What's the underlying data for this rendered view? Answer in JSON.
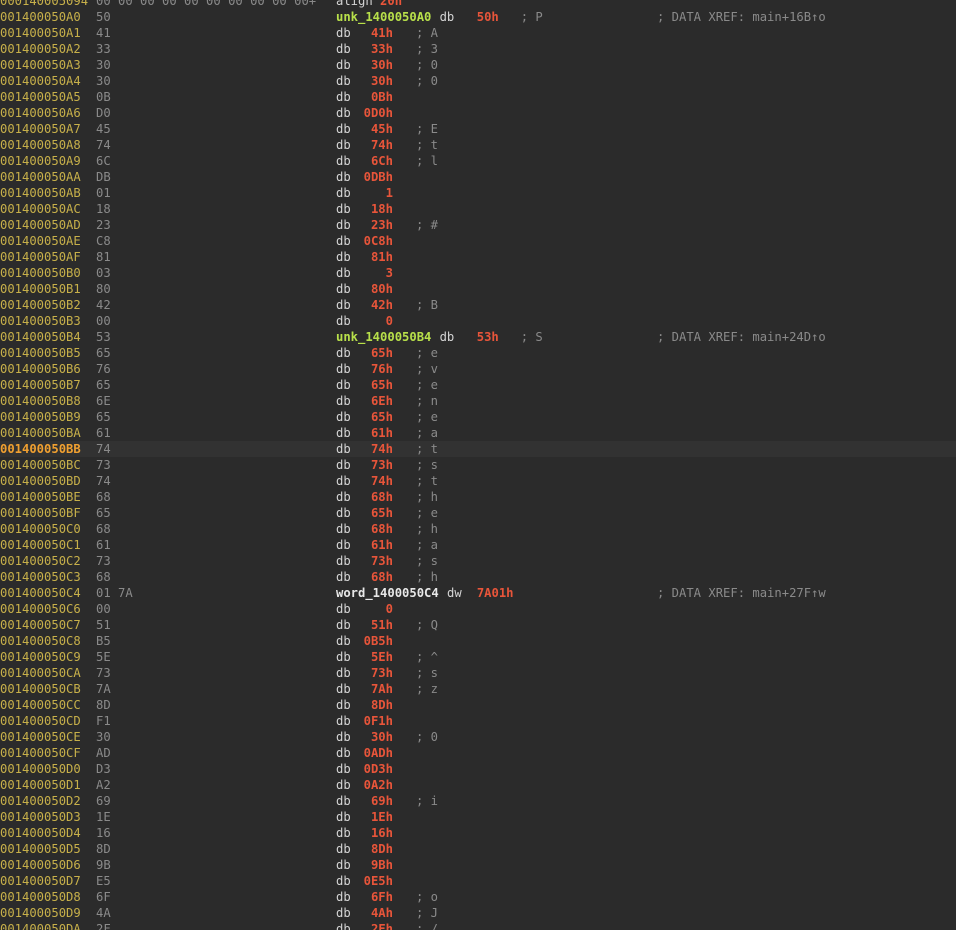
{
  "theme": {
    "background": "#2b2b2b",
    "address": "#c7b04a",
    "address_current": "#f0a030",
    "label": "#b8e04a",
    "value": "#e8553a",
    "comment": "#8a8a8a",
    "text": "#d4d4d4"
  },
  "top_line": {
    "address": "000140005094",
    "bytes": "00 00 00 00 00 00 00 00 00 00+",
    "mnemonic": "align",
    "operand": "20h"
  },
  "rows": [
    {
      "addr": "001400050A0",
      "bytes": "50",
      "label": "unk_1400050A0",
      "mnem": "db",
      "val": "50h",
      "cmt": "; P",
      "xref": "; DATA XREF: main+16B↑o"
    },
    {
      "addr": "001400050A1",
      "bytes": "41",
      "mnem": "db",
      "val": "41h",
      "cmt": "; A"
    },
    {
      "addr": "001400050A2",
      "bytes": "33",
      "mnem": "db",
      "val": "33h",
      "cmt": "; 3"
    },
    {
      "addr": "001400050A3",
      "bytes": "30",
      "mnem": "db",
      "val": "30h",
      "cmt": "; 0"
    },
    {
      "addr": "001400050A4",
      "bytes": "30",
      "mnem": "db",
      "val": "30h",
      "cmt": "; 0"
    },
    {
      "addr": "001400050A5",
      "bytes": "0B",
      "mnem": "db",
      "val": "0Bh"
    },
    {
      "addr": "001400050A6",
      "bytes": "D0",
      "mnem": "db",
      "val": "0D0h"
    },
    {
      "addr": "001400050A7",
      "bytes": "45",
      "mnem": "db",
      "val": "45h",
      "cmt": "; E"
    },
    {
      "addr": "001400050A8",
      "bytes": "74",
      "mnem": "db",
      "val": "74h",
      "cmt": "; t"
    },
    {
      "addr": "001400050A9",
      "bytes": "6C",
      "mnem": "db",
      "val": "6Ch",
      "cmt": "; l"
    },
    {
      "addr": "001400050AA",
      "bytes": "DB",
      "mnem": "db",
      "val": "0DBh"
    },
    {
      "addr": "001400050AB",
      "bytes": "01",
      "mnem": "db",
      "val": "1"
    },
    {
      "addr": "001400050AC",
      "bytes": "18",
      "mnem": "db",
      "val": "18h"
    },
    {
      "addr": "001400050AD",
      "bytes": "23",
      "mnem": "db",
      "val": "23h",
      "cmt": "; #"
    },
    {
      "addr": "001400050AE",
      "bytes": "C8",
      "mnem": "db",
      "val": "0C8h"
    },
    {
      "addr": "001400050AF",
      "bytes": "81",
      "mnem": "db",
      "val": "81h"
    },
    {
      "addr": "001400050B0",
      "bytes": "03",
      "mnem": "db",
      "val": "3"
    },
    {
      "addr": "001400050B1",
      "bytes": "80",
      "mnem": "db",
      "val": "80h"
    },
    {
      "addr": "001400050B2",
      "bytes": "42",
      "mnem": "db",
      "val": "42h",
      "cmt": "; B"
    },
    {
      "addr": "001400050B3",
      "bytes": "00",
      "mnem": "db",
      "val": "0"
    },
    {
      "addr": "001400050B4",
      "bytes": "53",
      "label": "unk_1400050B4",
      "mnem": "db",
      "val": "53h",
      "cmt": "; S",
      "xref": "; DATA XREF: main+24D↑o"
    },
    {
      "addr": "001400050B5",
      "bytes": "65",
      "mnem": "db",
      "val": "65h",
      "cmt": "; e"
    },
    {
      "addr": "001400050B6",
      "bytes": "76",
      "mnem": "db",
      "val": "76h",
      "cmt": "; v"
    },
    {
      "addr": "001400050B7",
      "bytes": "65",
      "mnem": "db",
      "val": "65h",
      "cmt": "; e"
    },
    {
      "addr": "001400050B8",
      "bytes": "6E",
      "mnem": "db",
      "val": "6Eh",
      "cmt": "; n"
    },
    {
      "addr": "001400050B9",
      "bytes": "65",
      "mnem": "db",
      "val": "65h",
      "cmt": "; e"
    },
    {
      "addr": "001400050BA",
      "bytes": "61",
      "mnem": "db",
      "val": "61h",
      "cmt": "; a"
    },
    {
      "addr": "001400050BB",
      "bytes": "74",
      "mnem": "db",
      "val": "74h",
      "cmt": "; t",
      "current": true
    },
    {
      "addr": "001400050BC",
      "bytes": "73",
      "mnem": "db",
      "val": "73h",
      "cmt": "; s"
    },
    {
      "addr": "001400050BD",
      "bytes": "74",
      "mnem": "db",
      "val": "74h",
      "cmt": "; t"
    },
    {
      "addr": "001400050BE",
      "bytes": "68",
      "mnem": "db",
      "val": "68h",
      "cmt": "; h"
    },
    {
      "addr": "001400050BF",
      "bytes": "65",
      "mnem": "db",
      "val": "65h",
      "cmt": "; e"
    },
    {
      "addr": "001400050C0",
      "bytes": "68",
      "mnem": "db",
      "val": "68h",
      "cmt": "; h"
    },
    {
      "addr": "001400050C1",
      "bytes": "61",
      "mnem": "db",
      "val": "61h",
      "cmt": "; a"
    },
    {
      "addr": "001400050C2",
      "bytes": "73",
      "mnem": "db",
      "val": "73h",
      "cmt": "; s"
    },
    {
      "addr": "001400050C3",
      "bytes": "68",
      "mnem": "db",
      "val": "68h",
      "cmt": "; h"
    },
    {
      "addr": "001400050C4",
      "bytes": "01 7A",
      "label": "word_1400050C4",
      "mnem": "dw",
      "val": "7A01h",
      "xref": "; DATA XREF: main+27F↑w",
      "plain": true
    },
    {
      "addr": "001400050C6",
      "bytes": "00",
      "mnem": "db",
      "val": "0"
    },
    {
      "addr": "001400050C7",
      "bytes": "51",
      "mnem": "db",
      "val": "51h",
      "cmt": "; Q"
    },
    {
      "addr": "001400050C8",
      "bytes": "B5",
      "mnem": "db",
      "val": "0B5h"
    },
    {
      "addr": "001400050C9",
      "bytes": "5E",
      "mnem": "db",
      "val": "5Eh",
      "cmt": "; ^"
    },
    {
      "addr": "001400050CA",
      "bytes": "73",
      "mnem": "db",
      "val": "73h",
      "cmt": "; s"
    },
    {
      "addr": "001400050CB",
      "bytes": "7A",
      "mnem": "db",
      "val": "7Ah",
      "cmt": "; z"
    },
    {
      "addr": "001400050CC",
      "bytes": "8D",
      "mnem": "db",
      "val": "8Dh"
    },
    {
      "addr": "001400050CD",
      "bytes": "F1",
      "mnem": "db",
      "val": "0F1h"
    },
    {
      "addr": "001400050CE",
      "bytes": "30",
      "mnem": "db",
      "val": "30h",
      "cmt": "; 0"
    },
    {
      "addr": "001400050CF",
      "bytes": "AD",
      "mnem": "db",
      "val": "0ADh"
    },
    {
      "addr": "001400050D0",
      "bytes": "D3",
      "mnem": "db",
      "val": "0D3h"
    },
    {
      "addr": "001400050D1",
      "bytes": "A2",
      "mnem": "db",
      "val": "0A2h"
    },
    {
      "addr": "001400050D2",
      "bytes": "69",
      "mnem": "db",
      "val": "69h",
      "cmt": "; i"
    },
    {
      "addr": "001400050D3",
      "bytes": "1E",
      "mnem": "db",
      "val": "1Eh"
    },
    {
      "addr": "001400050D4",
      "bytes": "16",
      "mnem": "db",
      "val": "16h"
    },
    {
      "addr": "001400050D5",
      "bytes": "8D",
      "mnem": "db",
      "val": "8Dh"
    },
    {
      "addr": "001400050D6",
      "bytes": "9B",
      "mnem": "db",
      "val": "9Bh"
    },
    {
      "addr": "001400050D7",
      "bytes": "E5",
      "mnem": "db",
      "val": "0E5h"
    },
    {
      "addr": "001400050D8",
      "bytes": "6F",
      "mnem": "db",
      "val": "6Fh",
      "cmt": "; o"
    },
    {
      "addr": "001400050D9",
      "bytes": "4A",
      "mnem": "db",
      "val": "4Ah",
      "cmt": "; J"
    },
    {
      "addr": "001400050DA",
      "bytes": "2F",
      "mnem": "db",
      "val": "2Fh",
      "cmt": "; /"
    }
  ]
}
